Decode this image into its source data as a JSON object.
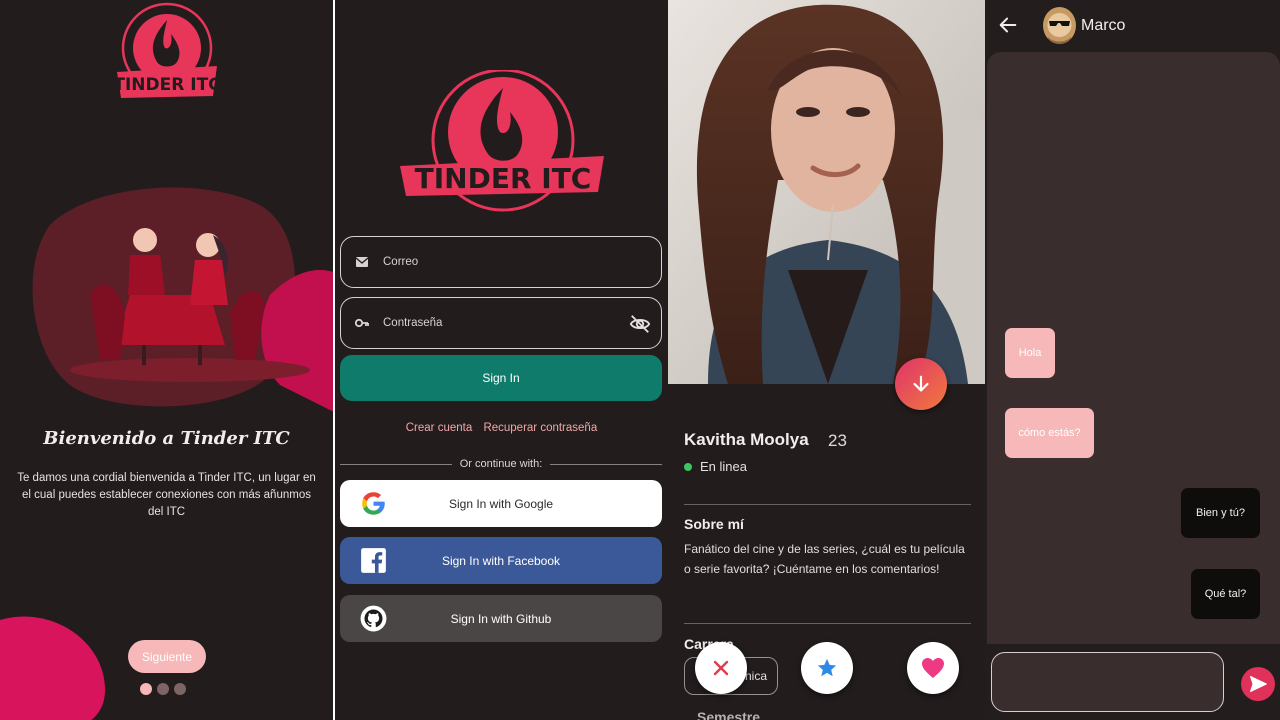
{
  "welcome": {
    "title": "Bienvenido a Tinder ITC",
    "text": "Te damos una cordial bienvenida a Tinder ITC, un lugar en el cual puedes establecer conexiones con más añunmos del ITC",
    "next_label": "Siguiente",
    "dots": 3,
    "active_dot": 0,
    "logo_text": "TINDER ITC"
  },
  "login": {
    "email_placeholder": "Correo",
    "password_placeholder": "Contraseña",
    "signin_label": "Sign In",
    "create_account": "Crear cuenta",
    "recover_password": "Recuperar contraseña",
    "continue_with": "Or continue with:",
    "google_label": "Sign In with Google",
    "facebook_label": "Sign In with Facebook",
    "github_label": "Sign In with Github",
    "logo_text": "TINDER ITC"
  },
  "profile": {
    "name": "Kavitha Moolya",
    "age": "23",
    "status": "En linea",
    "about_heading": "Sobre mí",
    "about_text": "Fanático del cine y de las series, ¿cuál es tu película o serie favorita? ¡Cuéntame en los comentarios!",
    "career_heading": "Carrera",
    "career_chip": "nica",
    "semester_heading": "Semestre"
  },
  "chat": {
    "contact_name": "Marco",
    "messages": [
      {
        "text": "Hola",
        "from": "them"
      },
      {
        "text": "cómo estás?",
        "from": "them"
      },
      {
        "text": "Bien y tú?",
        "from": "me"
      },
      {
        "text": "Qué tal?",
        "from": "me"
      }
    ],
    "input_placeholder": ""
  },
  "colors": {
    "background": "#221c1d",
    "accent_pink": "#f6b8b8",
    "brand_red": "#e8355a",
    "teal": "#0f7b6b",
    "facebook": "#3b5998",
    "github": "#4b4646"
  }
}
